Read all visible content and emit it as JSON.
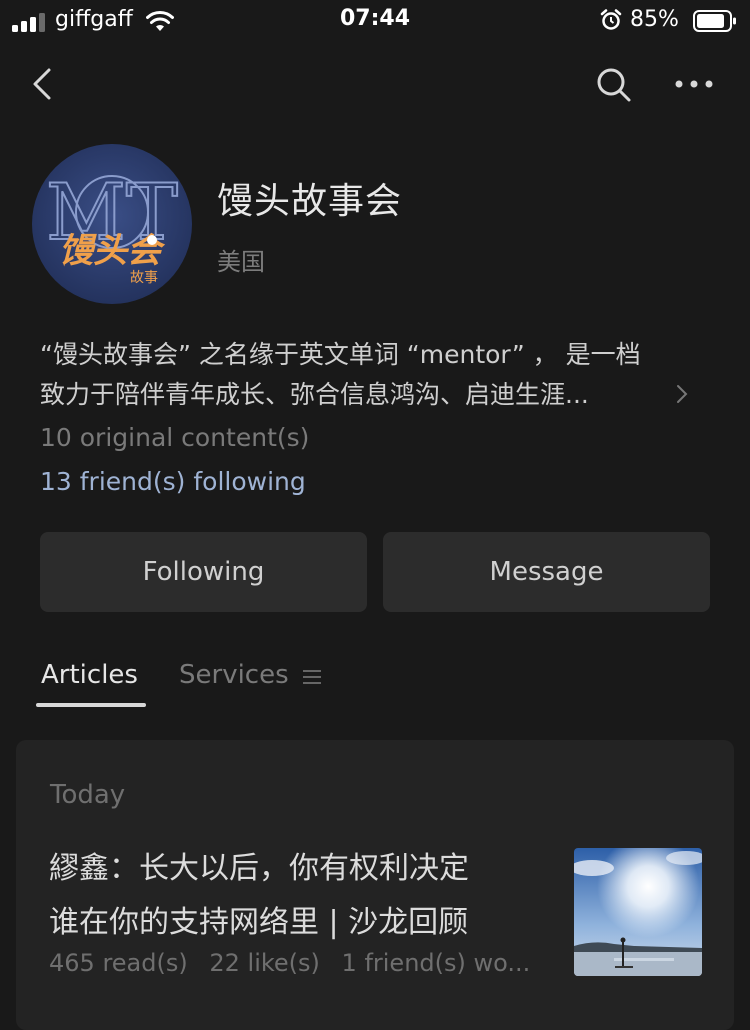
{
  "status_bar": {
    "carrier": "giffgaff",
    "time": "07:44",
    "battery_percent": "85%",
    "signal_bars": 3
  },
  "nav": {
    "back_icon": "chevron-left-icon",
    "search_icon": "search-icon",
    "more_icon": "more-dots-icon"
  },
  "profile": {
    "name": "馒头故事会",
    "region": "美国",
    "description_line1": "“馒头故事会” 之名缘于英文单词 “mentor” ， 是一档",
    "description_line2": "致力于陪伴青年成长、弥合信息鸿沟、启迪生涯...",
    "original_content": "10 original content(s)",
    "friends_following": "13 friend(s) following",
    "avatar_text": "馒头会"
  },
  "actions": {
    "following_label": "Following",
    "message_label": "Message"
  },
  "tabs": {
    "articles_label": "Articles",
    "services_label": "Services"
  },
  "feed": {
    "date_label": "Today",
    "article": {
      "title_line1": "繆鑫：长大以后，你有权利决定",
      "title_line2": "谁在你的支持网络里 | 沙龙回顾",
      "reads": "465 read(s)",
      "likes": "22 like(s)",
      "friends": "1 friend(s) wo..."
    }
  },
  "colors": {
    "background": "#191919",
    "card": "#232323",
    "button": "#2c2c2c",
    "link": "#9fb3d4",
    "avatar_bg": "#2b3b6b",
    "avatar_text": "#f0a04a"
  }
}
